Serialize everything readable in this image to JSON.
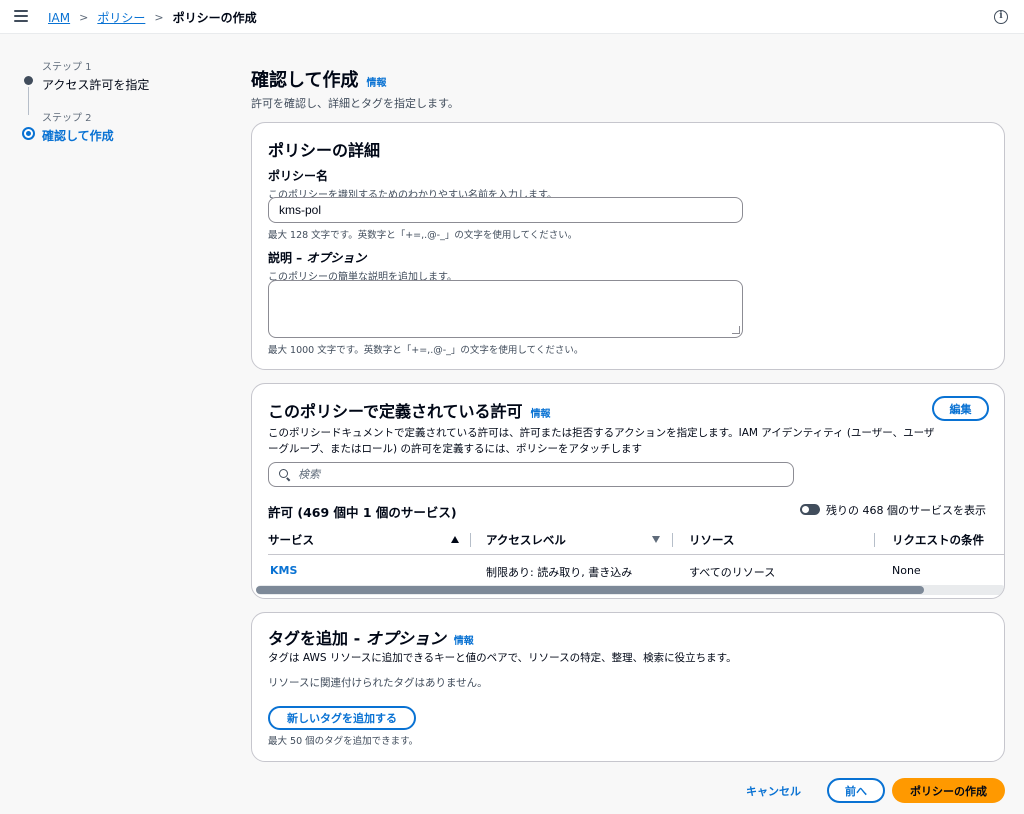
{
  "breadcrumb": {
    "items": [
      "IAM",
      "ポリシー"
    ],
    "current": "ポリシーの作成"
  },
  "steps": [
    {
      "number": "ステップ 1",
      "label": "アクセス許可を指定"
    },
    {
      "number": "ステップ 2",
      "label": "確認して作成"
    }
  ],
  "page": {
    "title": "確認して作成",
    "info": "情報",
    "description": "許可を確認し、詳細とタグを指定します。"
  },
  "details": {
    "title": "ポリシーの詳細",
    "name_label": "ポリシー名",
    "name_desc": "このポリシーを識別するためのわかりやすい名前を入力します。",
    "name_value": "kms-pol",
    "name_hint": "最大 128 文字です。英数字と「+=,.@-_」の文字を使用してください。",
    "desc_label": "説明 – ",
    "desc_label_optional": "オプション",
    "desc_desc": "このポリシーの簡単な説明を追加します。",
    "desc_value": "",
    "desc_hint": "最大 1000 文字です。英数字と「+=,.@-_」の文字を使用してください。"
  },
  "permissions": {
    "title": "このポリシーで定義されている許可",
    "info": "情報",
    "edit": "編集",
    "description_1": "このポリシードキュメントで定義されている許可は、許可または拒否するアクションを指定します。IAM アイデンティティ (ユーザー、ユーザ",
    "description_2": "ーグループ、またはロール) の許可を定義するには、ポリシーをアタッチします",
    "search_placeholder": "検索",
    "count": "許可 (469 個中 1 個のサービス)",
    "toggle_label": "残りの 468 個のサービスを表示",
    "columns": [
      "サービス",
      "アクセスレベル",
      "リソース",
      "リクエストの条件"
    ],
    "rows": [
      {
        "service": "KMS",
        "access": "制限あり: 読み取り, 書き込み",
        "resource": "すべてのリソース",
        "conditions": "None"
      }
    ],
    "scroll_fraction": 0.89
  },
  "tags": {
    "title": "タグを追加 - ",
    "title_optional": "オプション",
    "info": "情報",
    "description": "タグは AWS リソースに追加できるキーと値のペアで、リソースの特定、整理、検索に役立ちます。",
    "empty": "リソースに関連付けられたタグはありません。",
    "add_button": "新しいタグを追加する",
    "hint": "最大 50 個のタグを追加できます。"
  },
  "footer": {
    "cancel": "キャンセル",
    "previous": "前へ",
    "create": "ポリシーの作成"
  },
  "icons": {
    "info": "i"
  }
}
